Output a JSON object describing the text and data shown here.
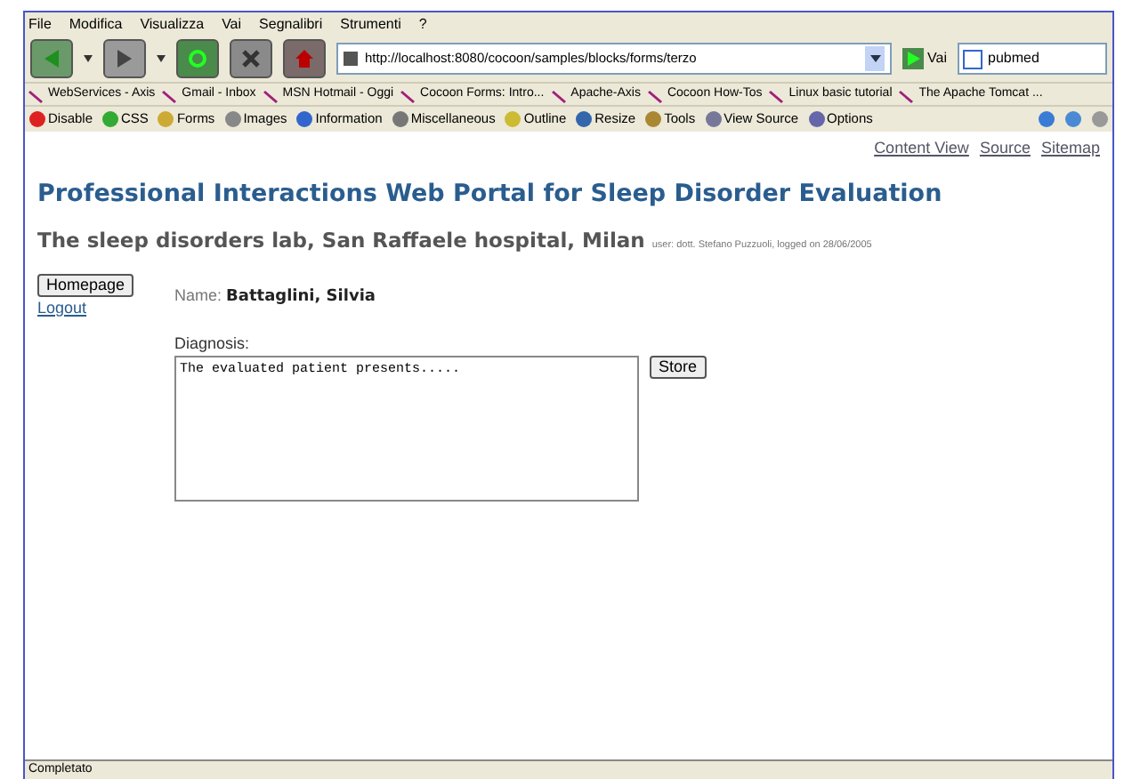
{
  "menu": [
    "File",
    "Modifica",
    "Visualizza",
    "Vai",
    "Segnalibri",
    "Strumenti",
    "?"
  ],
  "address": {
    "value": "http://localhost:8080/cocoon/samples/blocks/forms/terzo"
  },
  "go": "Vai",
  "search": {
    "value": "pubmed"
  },
  "bookmarks": [
    "WebServices - Axis",
    "Gmail - Inbox",
    "MSN Hotmail - Oggi",
    "Cocoon Forms: Intro...",
    "Apache-Axis",
    "Cocoon How-Tos",
    "Linux basic tutorial",
    "The Apache Tomcat ..."
  ],
  "dev_toolbar": [
    "Disable",
    "CSS",
    "Forms",
    "Images",
    "Information",
    "Miscellaneous",
    "Outline",
    "Resize",
    "Tools",
    "View Source",
    "Options"
  ],
  "top_links": [
    "Content View",
    "Source",
    "Sitemap"
  ],
  "title": "Professional Interactions Web Portal for Sleep Disorder Evaluation",
  "subtitle": "The sleep disorders lab, San Raffaele hospital, Milan",
  "user_info": "user: dott. Stefano Puzzuoli, logged on 28/06/2005",
  "homepage_button": "Homepage",
  "logout_link": "Logout",
  "name_label": "Name:",
  "name_value": "Battaglini, Silvia",
  "diagnosis_label": "Diagnosis:",
  "diagnosis": {
    "value": "The evaluated patient presents....."
  },
  "store_button": "Store",
  "status_bar": "Completato"
}
